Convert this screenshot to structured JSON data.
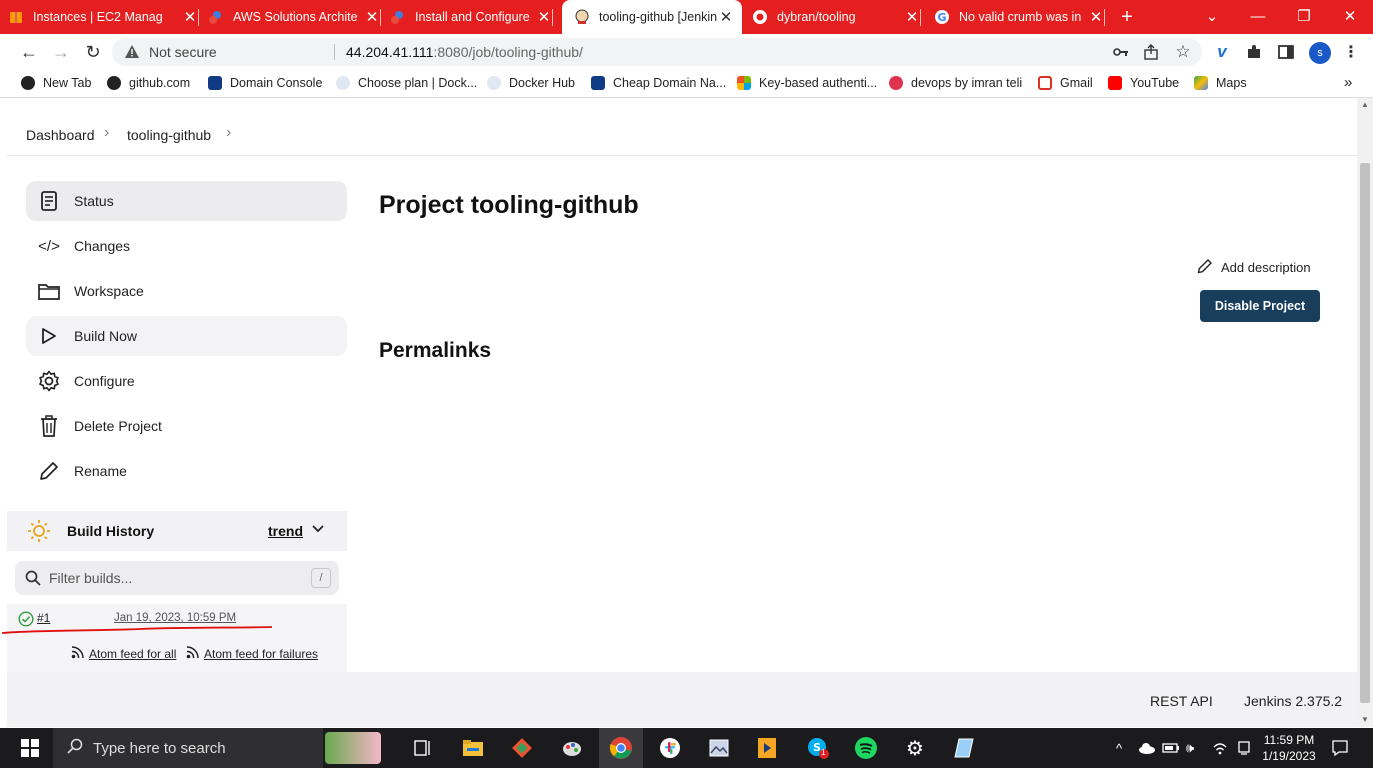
{
  "browser": {
    "tabs": [
      {
        "title": "Instances | EC2 Manag",
        "active": false
      },
      {
        "title": "AWS Solutions Archite",
        "active": false
      },
      {
        "title": "Install and Configure",
        "active": false
      },
      {
        "title": "tooling-github [Jenkin",
        "active": true
      },
      {
        "title": "dybran/tooling",
        "active": false
      },
      {
        "title": "No valid crumb was in",
        "active": false
      }
    ],
    "new_tab_symbol": "+",
    "security_label": "Not secure",
    "url_host": "44.204.41.111",
    "url_rest": ":8080/job/tooling-github/",
    "profile_initial": "s",
    "bookmarks": [
      {
        "label": "New Tab",
        "icon": "github-icon"
      },
      {
        "label": "github.com",
        "icon": "github-icon"
      },
      {
        "label": "Domain Console",
        "icon": "domain-icon"
      },
      {
        "label": "Choose plan | Dock...",
        "icon": "docker-icon"
      },
      {
        "label": "Docker Hub",
        "icon": "docker-icon"
      },
      {
        "label": "Cheap Domain Na...",
        "icon": "domain-icon"
      },
      {
        "label": "Key-based authenti...",
        "icon": "windows-icon"
      },
      {
        "label": "devops by imran teli",
        "icon": "circle-icon"
      },
      {
        "label": "Gmail",
        "icon": "gmail-icon"
      },
      {
        "label": "YouTube",
        "icon": "youtube-icon"
      },
      {
        "label": "Maps",
        "icon": "maps-icon"
      }
    ],
    "more_bookmarks": "»"
  },
  "jenkins": {
    "breadcrumb": [
      "Dashboard",
      "tooling-github"
    ],
    "sidebar": [
      {
        "label": "Status",
        "icon": "status-icon"
      },
      {
        "label": "Changes",
        "icon": "code-icon"
      },
      {
        "label": "Workspace",
        "icon": "folder-icon"
      },
      {
        "label": "Build Now",
        "icon": "play-icon"
      },
      {
        "label": "Configure",
        "icon": "gear-icon"
      },
      {
        "label": "Delete Project",
        "icon": "trash-icon"
      },
      {
        "label": "Rename",
        "icon": "pencil-icon"
      }
    ],
    "build_history": {
      "title": "Build History",
      "trend": "trend",
      "filter_placeholder": "Filter builds...",
      "filter_shortcut": "/",
      "builds": [
        {
          "number": "#1",
          "date": "Jan 19, 2023, 10:59 PM",
          "status": "success"
        }
      ],
      "feed_all": "Atom feed for all",
      "feed_failures": "Atom feed for failures"
    },
    "title": "Project tooling-github",
    "add_description": "Add description",
    "disable_button": "Disable Project",
    "permalinks": "Permalinks",
    "footer": {
      "rest_api": "REST API",
      "version": "Jenkins 2.375.2"
    }
  },
  "taskbar": {
    "search_placeholder": "Type here to search",
    "time": "11:59 PM",
    "date": "1/19/2023",
    "skype_badge": "1"
  },
  "colors": {
    "chrome_accent": "#e51f1f",
    "jenkins_button": "#183e5c",
    "success": "#2e9e3e",
    "annotation": "#e01010"
  }
}
